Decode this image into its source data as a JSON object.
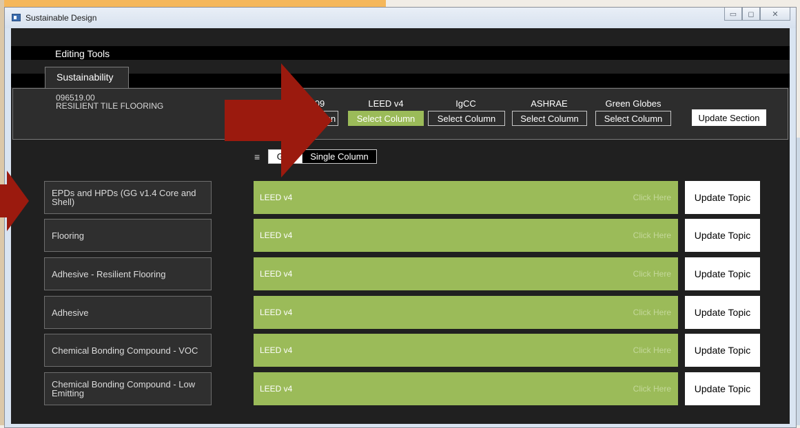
{
  "window": {
    "title": "Sustainable Design"
  },
  "toolbar": {
    "editing_tools": "Editing Tools"
  },
  "tabs": {
    "sustainability": "Sustainability"
  },
  "section": {
    "number": "096519.00",
    "title": "RESILIENT TILE FLOORING"
  },
  "columns": [
    {
      "header": "09",
      "button": "Select Column",
      "active": false
    },
    {
      "header": "LEED v4",
      "button": "Select Column",
      "active": true
    },
    {
      "header": "IgCC",
      "button": "Select Column",
      "active": false
    },
    {
      "header": "ASHRAE",
      "button": "Select Column",
      "active": false
    },
    {
      "header": "Green Globes",
      "button": "Select Column",
      "active": false
    }
  ],
  "update_section_label": "Update Section",
  "view_toggle": {
    "menu_glyph": "≡",
    "grid": "Grid",
    "single": "Single Column"
  },
  "topics": [
    {
      "label": "EPDs and HPDs (GG v1.4 Core and Shell)",
      "column": "LEED v4",
      "hint": "Click Here",
      "update": "Update Topic"
    },
    {
      "label": "Flooring",
      "column": "LEED v4",
      "hint": "Click Here",
      "update": "Update Topic"
    },
    {
      "label": "Adhesive - Resilient Flooring",
      "column": "LEED v4",
      "hint": "Click Here",
      "update": "Update Topic"
    },
    {
      "label": "Adhesive",
      "column": "LEED v4",
      "hint": "Click Here",
      "update": "Update Topic"
    },
    {
      "label": "Chemical Bonding Compound - VOC",
      "column": "LEED v4",
      "hint": "Click Here",
      "update": "Update Topic"
    },
    {
      "label": "Chemical Bonding Compound - Low Emitting",
      "column": "LEED v4",
      "hint": "Click Here",
      "update": "Update Topic"
    }
  ],
  "colors": {
    "accent_green": "#9bbb59",
    "panel_dark": "#2d2d2d",
    "arrow_red": "#9b1a0e"
  }
}
